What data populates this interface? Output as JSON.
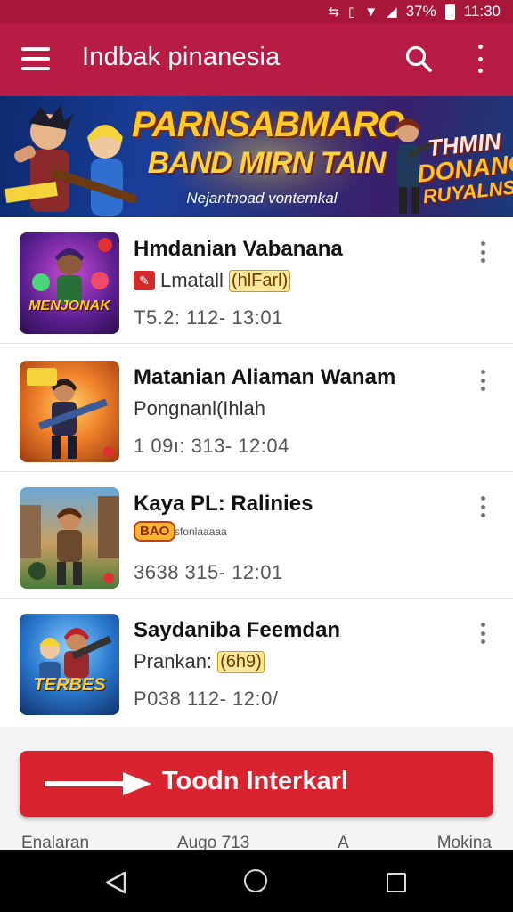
{
  "status_bar": {
    "battery": "37%",
    "time": "11:30"
  },
  "app_bar": {
    "title": "Indbak pinanesia",
    "menu_icon": "menu-icon",
    "search_icon": "search-icon",
    "more_icon": "more-vert-icon"
  },
  "banner": {
    "title": "PARNSABMARO",
    "subtitle": "BAND MIRN TAIN",
    "tagline": "Nejantnoad vontemkal",
    "side_line1": "THMIN",
    "side_line2": "DONANO",
    "side_line3": "RUYALNS"
  },
  "items": [
    {
      "title": "Hmdanian Vabanana",
      "subtitle": "Lmatall",
      "subtitle_highlight": "(hlFarl)",
      "time": "T5.2: 112- 13:01",
      "thumb_caption": "MENJONAK"
    },
    {
      "title": "Matanian Aliaman Wanam",
      "subtitle": "Pongnanl(Ihlah",
      "time": "1 09ı: 313- 12:04",
      "thumb_caption": ""
    },
    {
      "title": "Kaya PL: Ralinies",
      "badge": "BAO",
      "tiny": "sfonlaaaaa",
      "time": "3638 315- 12:01",
      "thumb_caption": ""
    },
    {
      "title": "Saydaniba Feemdan",
      "subtitle": "Prankan:",
      "subtitle_highlight": "(6h9)",
      "time": "P038 112- 12:0/",
      "thumb_caption": "TERBES"
    }
  ],
  "cta": {
    "label": "Toodn Interkarl"
  },
  "bottom_peek": {
    "left": "Enalaran",
    "middle": "Augo 713",
    "middle2": "A",
    "right": "Mokina"
  },
  "colors": {
    "primary": "#b81c44",
    "status": "#a8163a",
    "cta": "#d9232f",
    "banner_text": "#ffcb2b"
  }
}
